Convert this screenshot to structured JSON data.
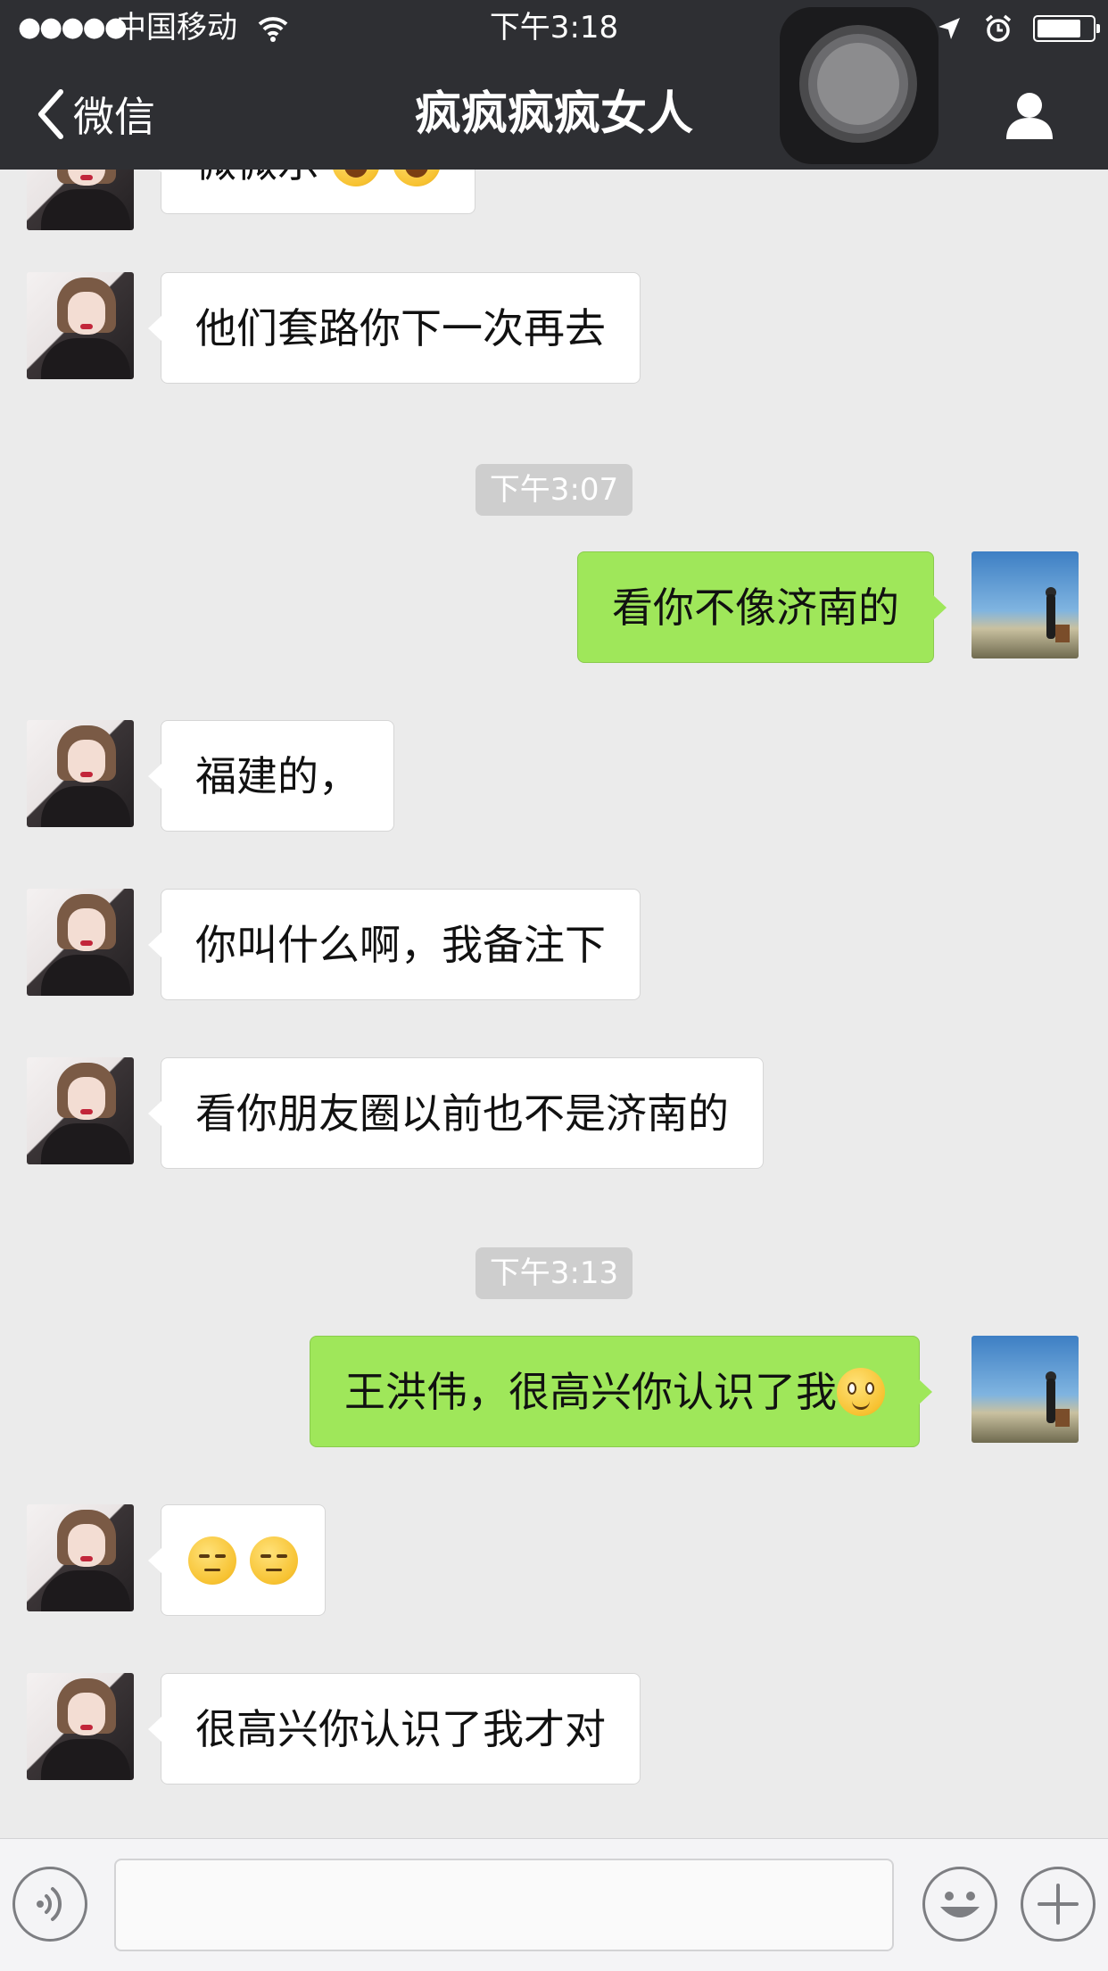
{
  "status_bar": {
    "signal": "●●●●●",
    "carrier": "中国移动",
    "time": "下午3:18"
  },
  "nav": {
    "back_label": "微信",
    "title": "疯疯疯疯女人"
  },
  "messages": [
    {
      "side": "in",
      "text": "微微乐"
    },
    {
      "side": "in",
      "text": "他们套路你下一次再去"
    },
    {
      "type": "time",
      "text": "下午3:07"
    },
    {
      "side": "out",
      "text": "看你不像济南的"
    },
    {
      "side": "in",
      "text": "福建的，"
    },
    {
      "side": "in",
      "text": "你叫什么啊，我备注下"
    },
    {
      "side": "in",
      "text": "看你朋友圈以前也不是济南的"
    },
    {
      "type": "time",
      "text": "下午3:13"
    },
    {
      "side": "out",
      "text": "王洪伟，很高兴你认识了我",
      "emoji": "smile-emoji"
    },
    {
      "side": "in",
      "text": "",
      "emoji": "unamused-emoji x2"
    },
    {
      "side": "in",
      "text": "很高兴你认识了我才对"
    }
  ],
  "input": {
    "value": "",
    "placeholder": ""
  },
  "icons": {
    "voice": "voice-icon",
    "emoji": "emoji-icon",
    "more": "plus-icon",
    "contact": "contact-icon",
    "back": "chevron-left-icon"
  },
  "colors": {
    "nav_bg": "#2e2f33",
    "chat_bg": "#ebebeb",
    "outgoing_bubble": "#9fe75a",
    "incoming_bubble": "#ffffff"
  }
}
